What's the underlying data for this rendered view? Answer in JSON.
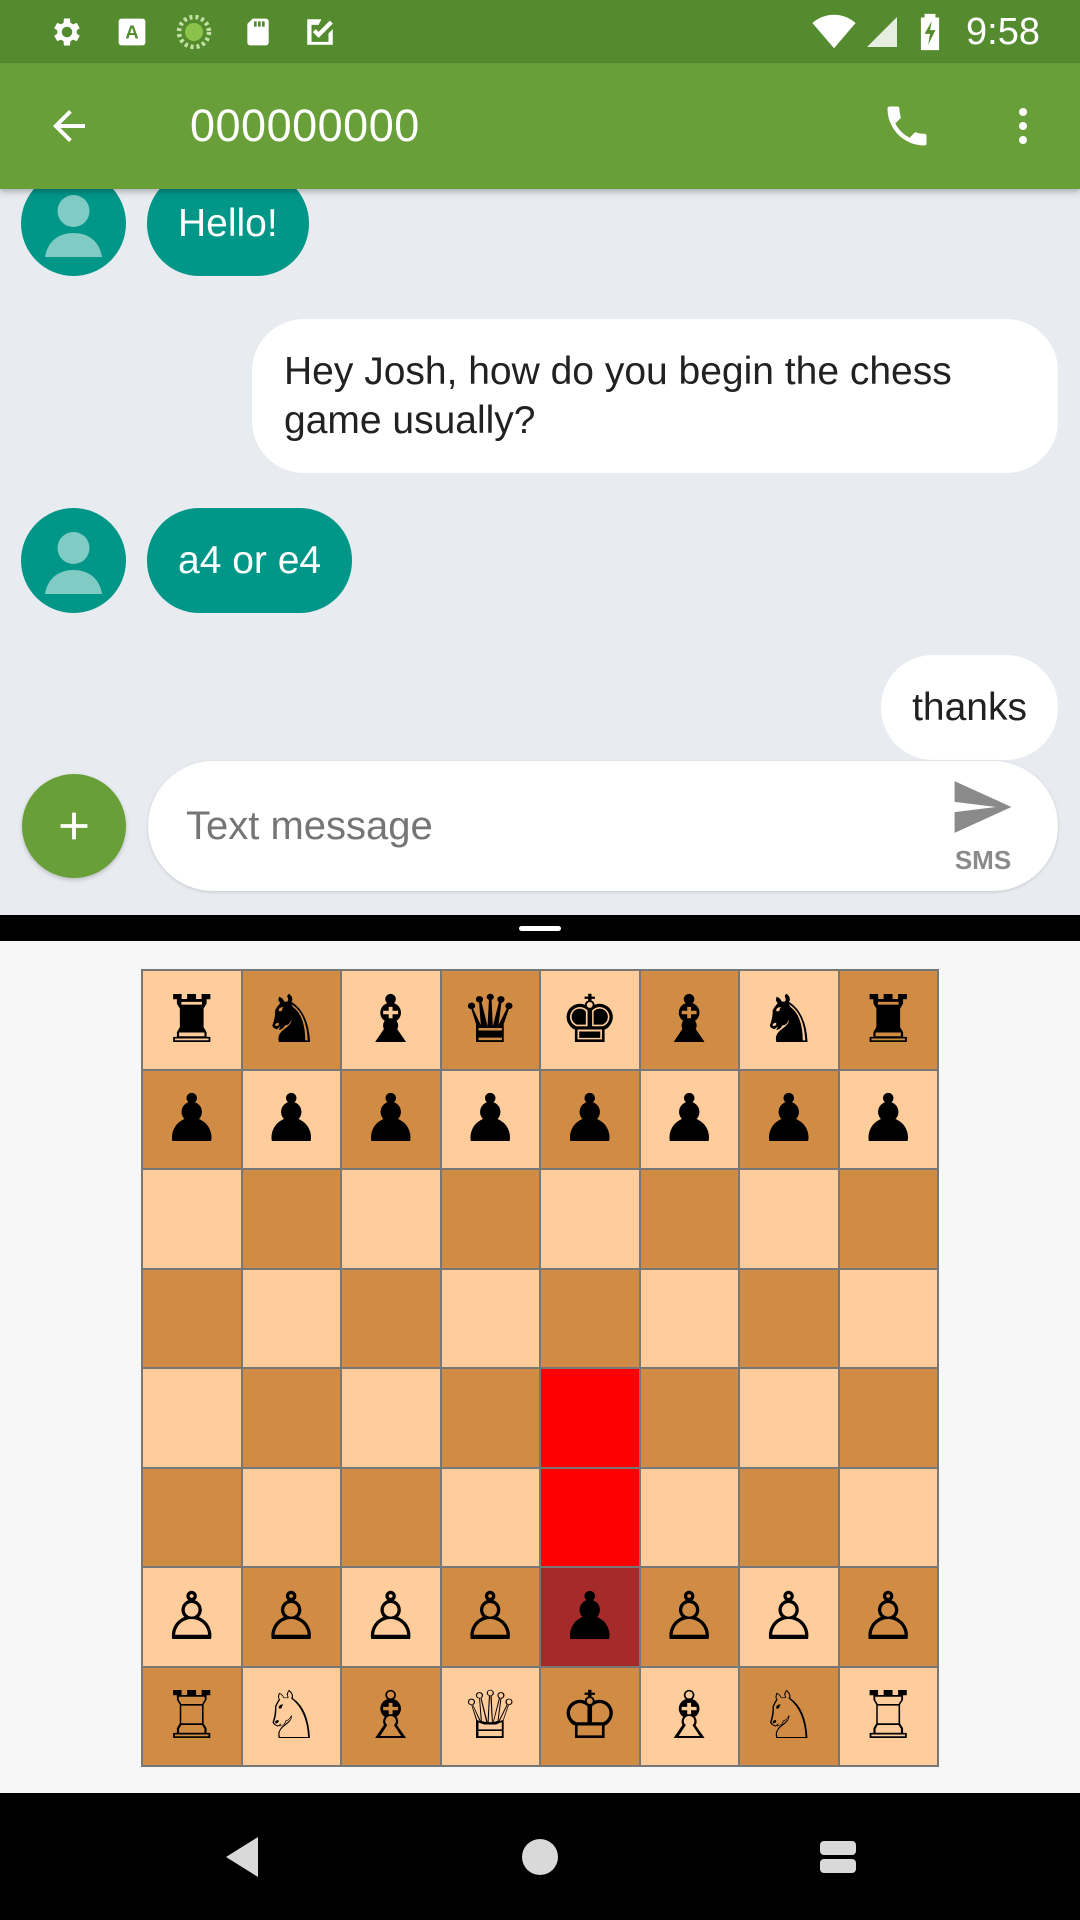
{
  "status_bar": {
    "time": "9:58",
    "left_icons": [
      "settings-icon",
      "text-a-icon",
      "spinner-icon",
      "sd-card-icon",
      "task-icon"
    ],
    "right_icons": [
      "wifi-icon",
      "signal-icon",
      "battery-charging-icon"
    ]
  },
  "app_bar": {
    "title": "000000000",
    "back_icon": "arrow-back-icon",
    "call_icon": "phone-icon",
    "more_icon": "more-vert-icon"
  },
  "messages": [
    {
      "direction": "incoming",
      "text": "Hello!"
    },
    {
      "direction": "outgoing",
      "text": "Hey Josh, how do you begin the chess game usually?"
    },
    {
      "direction": "incoming",
      "text": "a4 or e4"
    },
    {
      "direction": "outgoing",
      "text": "thanks"
    }
  ],
  "compose": {
    "placeholder": "Text message",
    "value": "",
    "send_label": "SMS",
    "add_icon": "plus-icon",
    "send_icon": "send-icon"
  },
  "chess": {
    "board": [
      [
        "♜",
        "♞",
        "♝",
        "♛",
        "♚",
        "♝",
        "♞",
        "♜"
      ],
      [
        "♟",
        "♟",
        "♟",
        "♟",
        "♟",
        "♟",
        "♟",
        "♟"
      ],
      [
        "",
        "",
        "",
        "",
        "",
        "",
        "",
        ""
      ],
      [
        "",
        "",
        "",
        "",
        "",
        "",
        "",
        ""
      ],
      [
        "",
        "",
        "",
        "",
        "",
        "",
        "",
        ""
      ],
      [
        "",
        "",
        "",
        "",
        "",
        "",
        "",
        ""
      ],
      [
        "♙",
        "♙",
        "♙",
        "♙",
        "♟",
        "♙",
        "♙",
        "♙"
      ],
      [
        "♖",
        "♘",
        "♗",
        "♕",
        "♔",
        "♗",
        "♘",
        "♖"
      ]
    ],
    "selected_square": "e2",
    "highlighted_squares": [
      "e3",
      "e4"
    ],
    "colors": {
      "light": "#ffcc9c",
      "dark": "#d08b45",
      "highlight_move": "#ff0000",
      "highlight_selected": "#a52a2a"
    }
  },
  "nav_bar": {
    "back_icon": "nav-back-icon",
    "home_icon": "nav-home-icon",
    "recents_icon": "nav-recents-icon"
  },
  "theme": {
    "status_bar": "#558b2f",
    "app_bar": "#689f38",
    "incoming_bubble": "#009688",
    "outgoing_bubble": "#ffffff",
    "conversation_bg": "#e8ebf0"
  }
}
